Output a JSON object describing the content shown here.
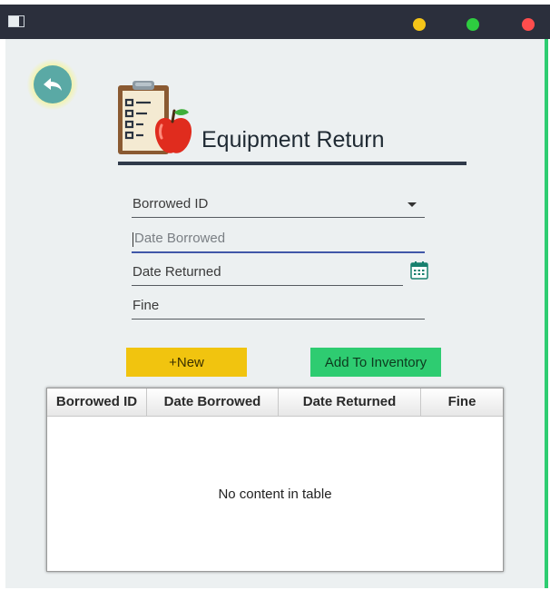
{
  "window": {
    "controls": {
      "minimize_color": "#f5c518",
      "maximize_color": "#2ecc40",
      "close_color": "#ff4d4d"
    }
  },
  "page": {
    "title": "Equipment Return",
    "accent_color": "#2ecc71"
  },
  "form": {
    "borrowed_id": {
      "placeholder": "Borrowed ID",
      "type": "dropdown"
    },
    "date_borrowed": {
      "placeholder": "Date Borrowed",
      "focused": true
    },
    "date_returned": {
      "placeholder": "Date Returned",
      "icon": "calendar-icon"
    },
    "fine": {
      "placeholder": "Fine"
    }
  },
  "buttons": {
    "new_label": "+New",
    "add_inventory_label": "Add To Inventory",
    "new_color": "#f1c40f",
    "add_color": "#2ecc71"
  },
  "table": {
    "columns": [
      "Borrowed ID",
      "Date Borrowed",
      "Date Returned",
      "Fine"
    ],
    "rows": [],
    "empty_message": "No content in table"
  }
}
